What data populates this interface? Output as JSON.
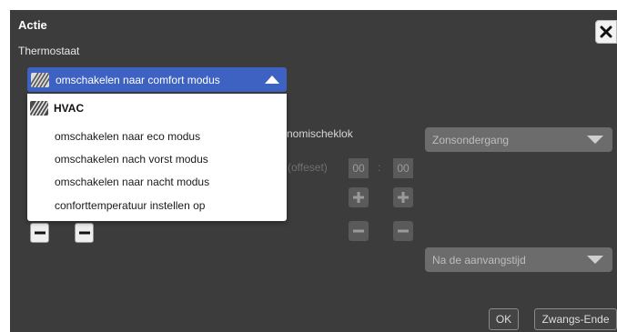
{
  "dialog": {
    "title": "Actie",
    "subtitle": "Thermostaat"
  },
  "select": {
    "selected_label": "omschakelen naar comfort modus",
    "icon": "hvac-icon",
    "accent_color": "#3e62c2"
  },
  "dropdown": {
    "group_label": "HVAC",
    "options": [
      "omschakelen naar eco modus",
      "omschakelen nach vorst modus",
      "omschakelen naar nacht modus",
      "conforttemperatuur instellen op"
    ]
  },
  "background": {
    "clock_label": "nomischeklok",
    "offset_label": "(offeset)",
    "hours": "00",
    "minutes": "00",
    "sun_select": "Zonsondergang",
    "start_select": "Na de aanvangstijd"
  },
  "buttons": {
    "ok": "OK",
    "force_end": "Zwangs-Ende"
  }
}
